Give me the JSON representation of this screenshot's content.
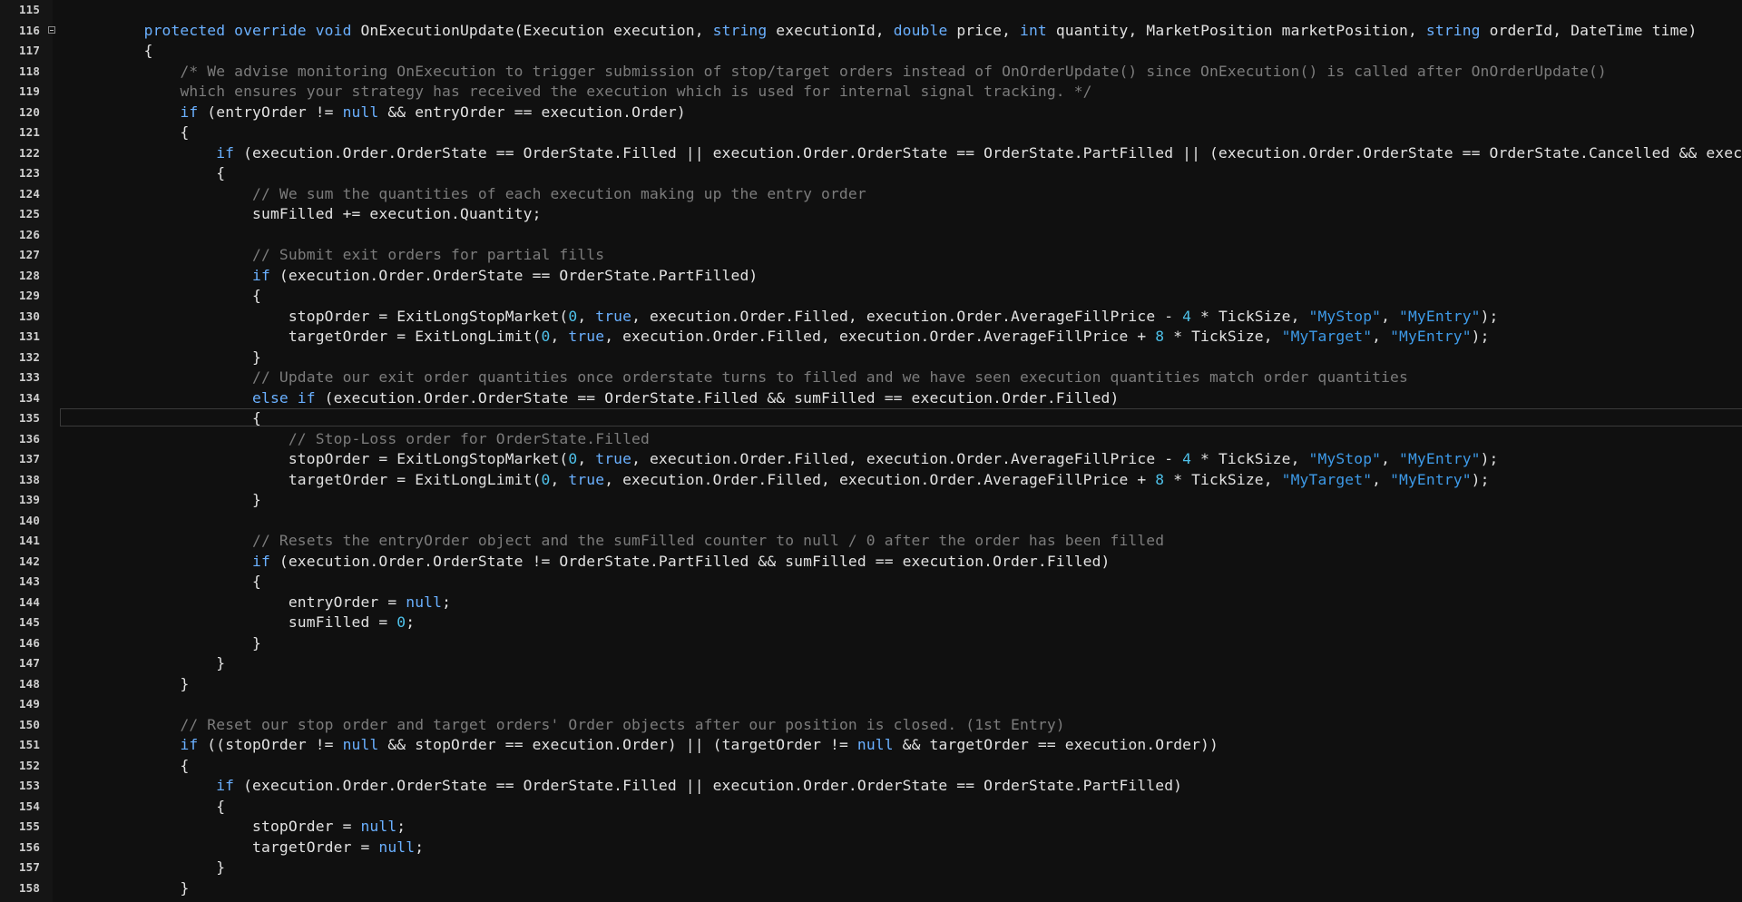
{
  "editor": {
    "current_line": 135,
    "folded_line": 116,
    "lines": [
      {
        "n": "115",
        "i": 0,
        "t": []
      },
      {
        "n": "116",
        "i": 2,
        "t": [
          [
            "kw",
            "protected override void "
          ],
          [
            "tx",
            "OnExecutionUpdate(Execution execution, "
          ],
          [
            "kw",
            "string "
          ],
          [
            "tx",
            "executionId, "
          ],
          [
            "kw",
            "double "
          ],
          [
            "tx",
            "price, "
          ],
          [
            "kw",
            "int "
          ],
          [
            "tx",
            "quantity, MarketPosition marketPosition, "
          ],
          [
            "kw",
            "string "
          ],
          [
            "tx",
            "orderId, DateTime time)"
          ]
        ]
      },
      {
        "n": "117",
        "i": 2,
        "t": [
          [
            "tx",
            "{"
          ]
        ]
      },
      {
        "n": "118",
        "i": 3,
        "t": [
          [
            "cm",
            "/* We advise monitoring OnExecution to trigger submission of stop/target orders instead of OnOrderUpdate() since OnExecution() is called after OnOrderUpdate()"
          ]
        ]
      },
      {
        "n": "119",
        "i": 3,
        "t": [
          [
            "cm",
            "which ensures your strategy has received the execution which is used for internal signal tracking. */"
          ]
        ]
      },
      {
        "n": "120",
        "i": 3,
        "t": [
          [
            "kw",
            "if "
          ],
          [
            "tx",
            "(entryOrder != "
          ],
          [
            "kw",
            "null "
          ],
          [
            "tx",
            "&& entryOrder == execution.Order)"
          ]
        ]
      },
      {
        "n": "121",
        "i": 3,
        "t": [
          [
            "tx",
            "{"
          ]
        ]
      },
      {
        "n": "122",
        "i": 4,
        "t": [
          [
            "kw",
            "if "
          ],
          [
            "tx",
            "(execution.Order.OrderState == OrderState.Filled || execution.Order.OrderState == OrderState.PartFilled || (execution.Order.OrderState == OrderState.Cancelled && execution.Or"
          ]
        ]
      },
      {
        "n": "123",
        "i": 4,
        "t": [
          [
            "tx",
            "{"
          ]
        ]
      },
      {
        "n": "124",
        "i": 5,
        "t": [
          [
            "cm",
            "// We sum the quantities of each execution making up the entry order"
          ]
        ]
      },
      {
        "n": "125",
        "i": 5,
        "t": [
          [
            "tx",
            "sumFilled += execution.Quantity;"
          ]
        ]
      },
      {
        "n": "126",
        "i": 0,
        "t": []
      },
      {
        "n": "127",
        "i": 5,
        "t": [
          [
            "cm",
            "// Submit exit orders for partial fills"
          ]
        ]
      },
      {
        "n": "128",
        "i": 5,
        "t": [
          [
            "kw",
            "if "
          ],
          [
            "tx",
            "(execution.Order.OrderState == OrderState.PartFilled)"
          ]
        ]
      },
      {
        "n": "129",
        "i": 5,
        "t": [
          [
            "tx",
            "{"
          ]
        ]
      },
      {
        "n": "130",
        "i": 6,
        "t": [
          [
            "tx",
            "stopOrder = ExitLongStopMarket("
          ],
          [
            "num",
            "0"
          ],
          [
            "tx",
            ", "
          ],
          [
            "kw",
            "true"
          ],
          [
            "tx",
            ", execution.Order.Filled, execution.Order.AverageFillPrice - "
          ],
          [
            "num",
            "4"
          ],
          [
            "tx",
            " * TickSize, "
          ],
          [
            "str",
            "\"MyStop\""
          ],
          [
            "tx",
            ", "
          ],
          [
            "str",
            "\"MyEntry\""
          ],
          [
            "tx",
            ");"
          ]
        ]
      },
      {
        "n": "131",
        "i": 6,
        "t": [
          [
            "tx",
            "targetOrder = ExitLongLimit("
          ],
          [
            "num",
            "0"
          ],
          [
            "tx",
            ", "
          ],
          [
            "kw",
            "true"
          ],
          [
            "tx",
            ", execution.Order.Filled, execution.Order.AverageFillPrice + "
          ],
          [
            "num",
            "8"
          ],
          [
            "tx",
            " * TickSize, "
          ],
          [
            "str",
            "\"MyTarget\""
          ],
          [
            "tx",
            ", "
          ],
          [
            "str",
            "\"MyEntry\""
          ],
          [
            "tx",
            ");"
          ]
        ]
      },
      {
        "n": "132",
        "i": 5,
        "t": [
          [
            "tx",
            "}"
          ]
        ]
      },
      {
        "n": "133",
        "i": 5,
        "t": [
          [
            "cm",
            "// Update our exit order quantities once orderstate turns to filled and we have seen execution quantities match order quantities"
          ]
        ]
      },
      {
        "n": "134",
        "i": 5,
        "t": [
          [
            "kw",
            "else if "
          ],
          [
            "tx",
            "(execution.Order.OrderState == OrderState.Filled && sumFilled == execution.Order.Filled)"
          ]
        ]
      },
      {
        "n": "135",
        "i": 5,
        "t": [
          [
            "tx",
            "{"
          ]
        ]
      },
      {
        "n": "136",
        "i": 6,
        "t": [
          [
            "cm",
            "// Stop-Loss order for OrderState.Filled"
          ]
        ]
      },
      {
        "n": "137",
        "i": 6,
        "t": [
          [
            "tx",
            "stopOrder = ExitLongStopMarket("
          ],
          [
            "num",
            "0"
          ],
          [
            "tx",
            ", "
          ],
          [
            "kw",
            "true"
          ],
          [
            "tx",
            ", execution.Order.Filled, execution.Order.AverageFillPrice - "
          ],
          [
            "num",
            "4"
          ],
          [
            "tx",
            " * TickSize, "
          ],
          [
            "str",
            "\"MyStop\""
          ],
          [
            "tx",
            ", "
          ],
          [
            "str",
            "\"MyEntry\""
          ],
          [
            "tx",
            ");"
          ]
        ]
      },
      {
        "n": "138",
        "i": 6,
        "t": [
          [
            "tx",
            "targetOrder = ExitLongLimit("
          ],
          [
            "num",
            "0"
          ],
          [
            "tx",
            ", "
          ],
          [
            "kw",
            "true"
          ],
          [
            "tx",
            ", execution.Order.Filled, execution.Order.AverageFillPrice + "
          ],
          [
            "num",
            "8"
          ],
          [
            "tx",
            " * TickSize, "
          ],
          [
            "str",
            "\"MyTarget\""
          ],
          [
            "tx",
            ", "
          ],
          [
            "str",
            "\"MyEntry\""
          ],
          [
            "tx",
            ");"
          ]
        ]
      },
      {
        "n": "139",
        "i": 5,
        "t": [
          [
            "tx",
            "}"
          ]
        ]
      },
      {
        "n": "140",
        "i": 0,
        "t": []
      },
      {
        "n": "141",
        "i": 5,
        "t": [
          [
            "cm",
            "// Resets the entryOrder object and the sumFilled counter to null / 0 after the order has been filled"
          ]
        ]
      },
      {
        "n": "142",
        "i": 5,
        "t": [
          [
            "kw",
            "if "
          ],
          [
            "tx",
            "(execution.Order.OrderState != OrderState.PartFilled && sumFilled == execution.Order.Filled)"
          ]
        ]
      },
      {
        "n": "143",
        "i": 5,
        "t": [
          [
            "tx",
            "{"
          ]
        ]
      },
      {
        "n": "144",
        "i": 6,
        "t": [
          [
            "tx",
            "entryOrder = "
          ],
          [
            "kw",
            "null"
          ],
          [
            "tx",
            ";"
          ]
        ]
      },
      {
        "n": "145",
        "i": 6,
        "t": [
          [
            "tx",
            "sumFilled = "
          ],
          [
            "num",
            "0"
          ],
          [
            "tx",
            ";"
          ]
        ]
      },
      {
        "n": "146",
        "i": 5,
        "t": [
          [
            "tx",
            "}"
          ]
        ]
      },
      {
        "n": "147",
        "i": 4,
        "t": [
          [
            "tx",
            "}"
          ]
        ]
      },
      {
        "n": "148",
        "i": 3,
        "t": [
          [
            "tx",
            "}"
          ]
        ]
      },
      {
        "n": "149",
        "i": 0,
        "t": []
      },
      {
        "n": "150",
        "i": 3,
        "t": [
          [
            "cm",
            "// Reset our stop order and target orders' Order objects after our position is closed. (1st Entry)"
          ]
        ]
      },
      {
        "n": "151",
        "i": 3,
        "t": [
          [
            "kw",
            "if "
          ],
          [
            "tx",
            "((stopOrder != "
          ],
          [
            "kw",
            "null "
          ],
          [
            "tx",
            "&& stopOrder == execution.Order) || (targetOrder != "
          ],
          [
            "kw",
            "null "
          ],
          [
            "tx",
            "&& targetOrder == execution.Order))"
          ]
        ]
      },
      {
        "n": "152",
        "i": 3,
        "t": [
          [
            "tx",
            "{"
          ]
        ]
      },
      {
        "n": "153",
        "i": 4,
        "t": [
          [
            "kw",
            "if "
          ],
          [
            "tx",
            "(execution.Order.OrderState == OrderState.Filled || execution.Order.OrderState == OrderState.PartFilled)"
          ]
        ]
      },
      {
        "n": "154",
        "i": 4,
        "t": [
          [
            "tx",
            "{"
          ]
        ]
      },
      {
        "n": "155",
        "i": 5,
        "t": [
          [
            "tx",
            "stopOrder = "
          ],
          [
            "kw",
            "null"
          ],
          [
            "tx",
            ";"
          ]
        ]
      },
      {
        "n": "156",
        "i": 5,
        "t": [
          [
            "tx",
            "targetOrder = "
          ],
          [
            "kw",
            "null"
          ],
          [
            "tx",
            ";"
          ]
        ]
      },
      {
        "n": "157",
        "i": 4,
        "t": [
          [
            "tx",
            "}"
          ]
        ]
      },
      {
        "n": "158",
        "i": 3,
        "t": [
          [
            "tx",
            "}"
          ]
        ]
      }
    ]
  }
}
